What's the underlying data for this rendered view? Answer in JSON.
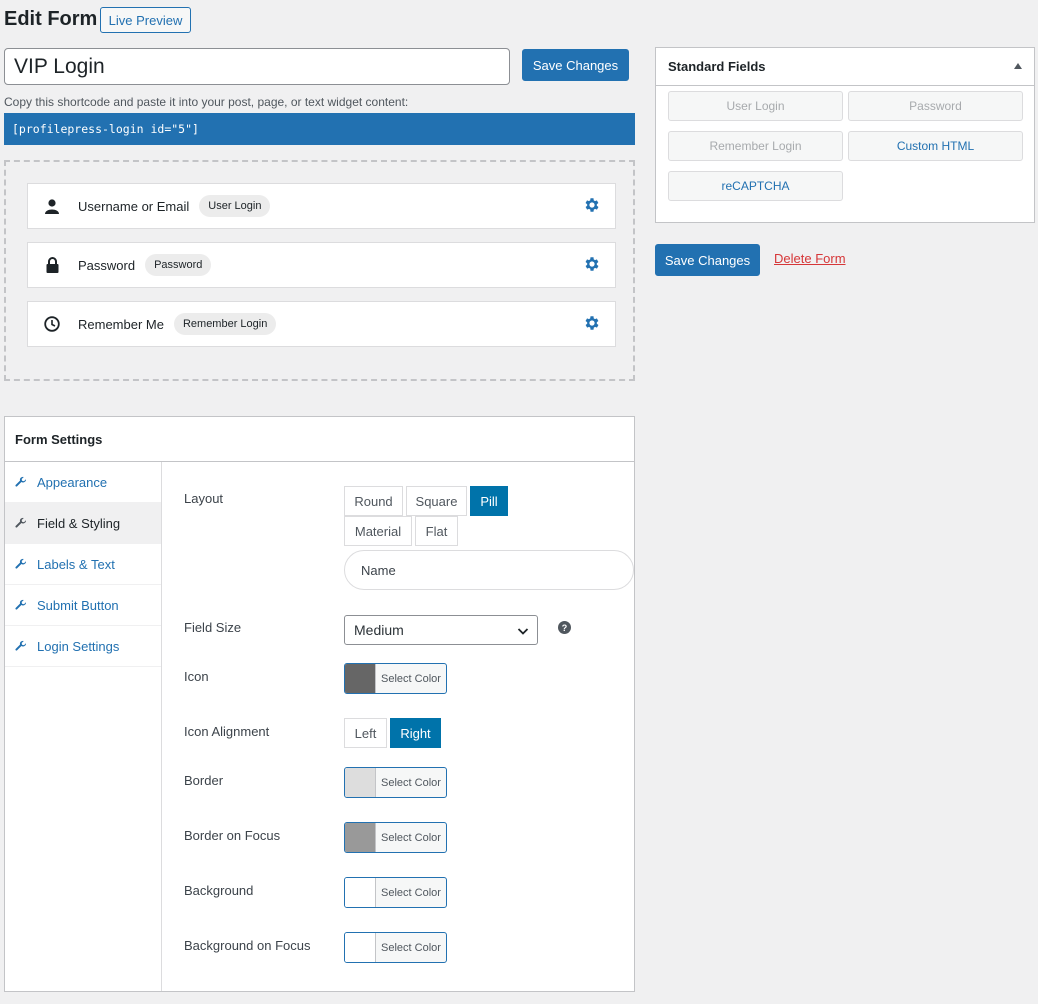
{
  "header": {
    "title": "Edit Form",
    "live_preview": "Live Preview",
    "form_name": "VIP Login",
    "save_label": "Save Changes",
    "shortcode_hint": "Copy this shortcode and paste it into your post, page, or text widget content:",
    "shortcode": "[profilepress-login id=\"5\"]"
  },
  "builder": {
    "fields": [
      {
        "label": "Username or Email",
        "tag": "User Login",
        "icon": "user-icon"
      },
      {
        "label": "Password",
        "tag": "Password",
        "icon": "lock-icon"
      },
      {
        "label": "Remember Me",
        "tag": "Remember Login",
        "icon": "clock-icon"
      }
    ]
  },
  "standard_fields": {
    "title": "Standard Fields",
    "items": [
      "User Login",
      "Password",
      "Remember Login",
      "Custom HTML",
      "reCAPTCHA"
    ]
  },
  "sidebar_actions": {
    "save_label": "Save Changes",
    "delete_label": "Delete Form"
  },
  "settings": {
    "title": "Form Settings",
    "tabs": [
      "Appearance",
      "Field & Styling",
      "Labels & Text",
      "Submit Button",
      "Login Settings"
    ],
    "active_tab": "Field & Styling",
    "layout_label": "Layout",
    "layout_options": [
      "Round",
      "Square",
      "Pill",
      "Material",
      "Flat"
    ],
    "layout_selected": "Pill",
    "preview_placeholder": "Name",
    "field_size_label": "Field Size",
    "field_size_value": "Medium",
    "icon_label": "Icon",
    "icon_alignment_label": "Icon Alignment",
    "alignment_options": [
      "Left",
      "Right"
    ],
    "alignment_selected": "Right",
    "border_label": "Border",
    "border_focus_label": "Border on Focus",
    "background_label": "Background",
    "background_focus_label": "Background on Focus",
    "select_color": "Select Color",
    "colors": {
      "icon": "#666666",
      "border": "#dddddd",
      "border_focus": "#999999",
      "background": "#ffffff",
      "background_focus": "#ffffff"
    }
  },
  "theme": {
    "accent": "#2271b1",
    "active_segment": "#0073aa",
    "danger": "#d63638"
  }
}
